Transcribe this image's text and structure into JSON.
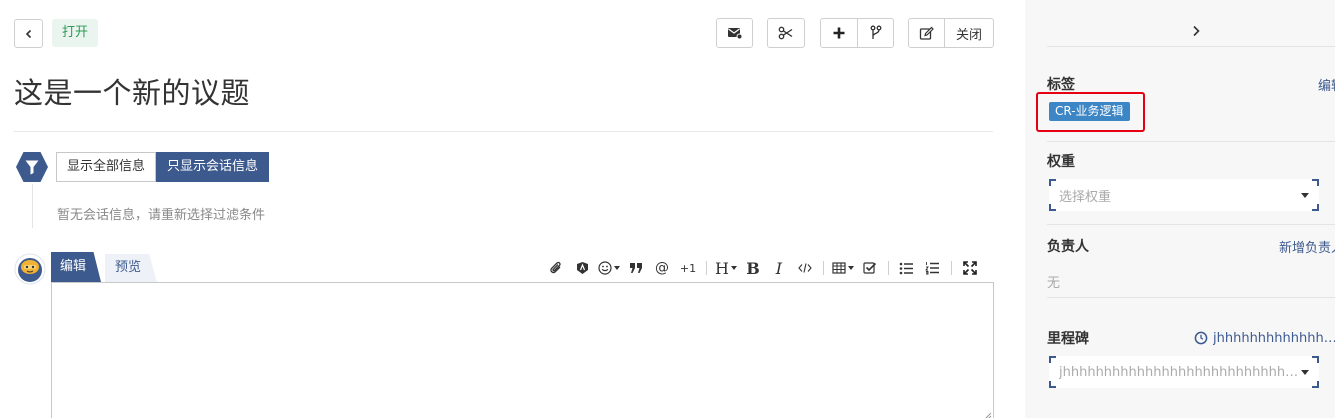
{
  "header": {
    "status": "打开",
    "close_label": "关闭"
  },
  "issue": {
    "title": "这是一个新的议题"
  },
  "activity": {
    "filters": [
      "显示全部信息",
      "只显示会话信息"
    ],
    "active_filter": "只显示会话信息",
    "empty_message": "暂无会话信息，请重新选择过滤条件"
  },
  "editor": {
    "tabs": [
      "编辑",
      "预览"
    ],
    "active_tab": "编辑",
    "toolbar": {
      "at": "@",
      "plus_one": "+1",
      "heading": "H",
      "bold": "B",
      "italic": "I"
    }
  },
  "sidebar": {
    "labels": {
      "title": "标签",
      "edit_link": "编辑",
      "tags": [
        "CR-业务逻辑"
      ],
      "tag_color": "#3d86c6"
    },
    "weight": {
      "title": "权重",
      "placeholder": "选择权重"
    },
    "assignee": {
      "title": "负责人",
      "add_link": "新增负责人",
      "value": "无"
    },
    "milestone": {
      "title": "里程碑",
      "current": "jhhhhhhhhhhhhhhhh...",
      "select_value": "jhhhhhhhhhhhhhhhhhhhhhhhhhhhhhhhh..."
    }
  },
  "colors": {
    "accent": "#3d5a8e",
    "status_open_bg": "#e9f5ee",
    "status_open_text": "#2f9a55",
    "highlight": "#e60012"
  }
}
